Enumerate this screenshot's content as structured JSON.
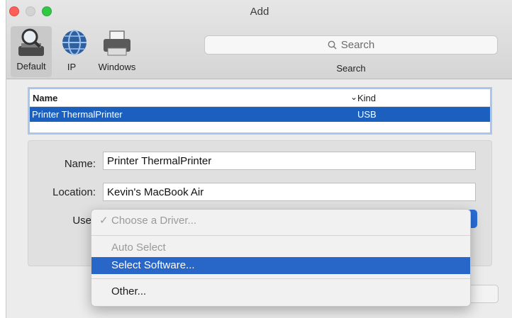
{
  "window": {
    "title": "Add"
  },
  "toolbar": {
    "items": [
      {
        "label": "Default",
        "icon": "magnifier-printer-icon"
      },
      {
        "label": "IP",
        "icon": "globe-icon"
      },
      {
        "label": "Windows",
        "icon": "printer-icon"
      }
    ],
    "search": {
      "placeholder": "Search",
      "label": "Search"
    }
  },
  "printer_list": {
    "columns": {
      "name": "Name",
      "kind": "Kind"
    },
    "rows": [
      {
        "name": "Printer ThermalPrinter",
        "kind": "USB"
      }
    ]
  },
  "details": {
    "name_label": "Name:",
    "name_value": "Printer ThermalPrinter",
    "location_label": "Location:",
    "location_value": "Kevin's MacBook Air",
    "use_label": "Use"
  },
  "driver_menu": {
    "checkmark": "✓",
    "items": [
      {
        "label": "Choose a Driver...",
        "state": "checked-disabled"
      },
      {
        "label": "Auto Select",
        "state": "disabled"
      },
      {
        "label": "Select Software...",
        "state": "highlighted"
      },
      {
        "label": "Other...",
        "state": "enabled"
      }
    ]
  },
  "colors": {
    "selection": "#1b5fbf",
    "menu_highlight": "#2866c7",
    "accent": "#2a6ed8"
  }
}
